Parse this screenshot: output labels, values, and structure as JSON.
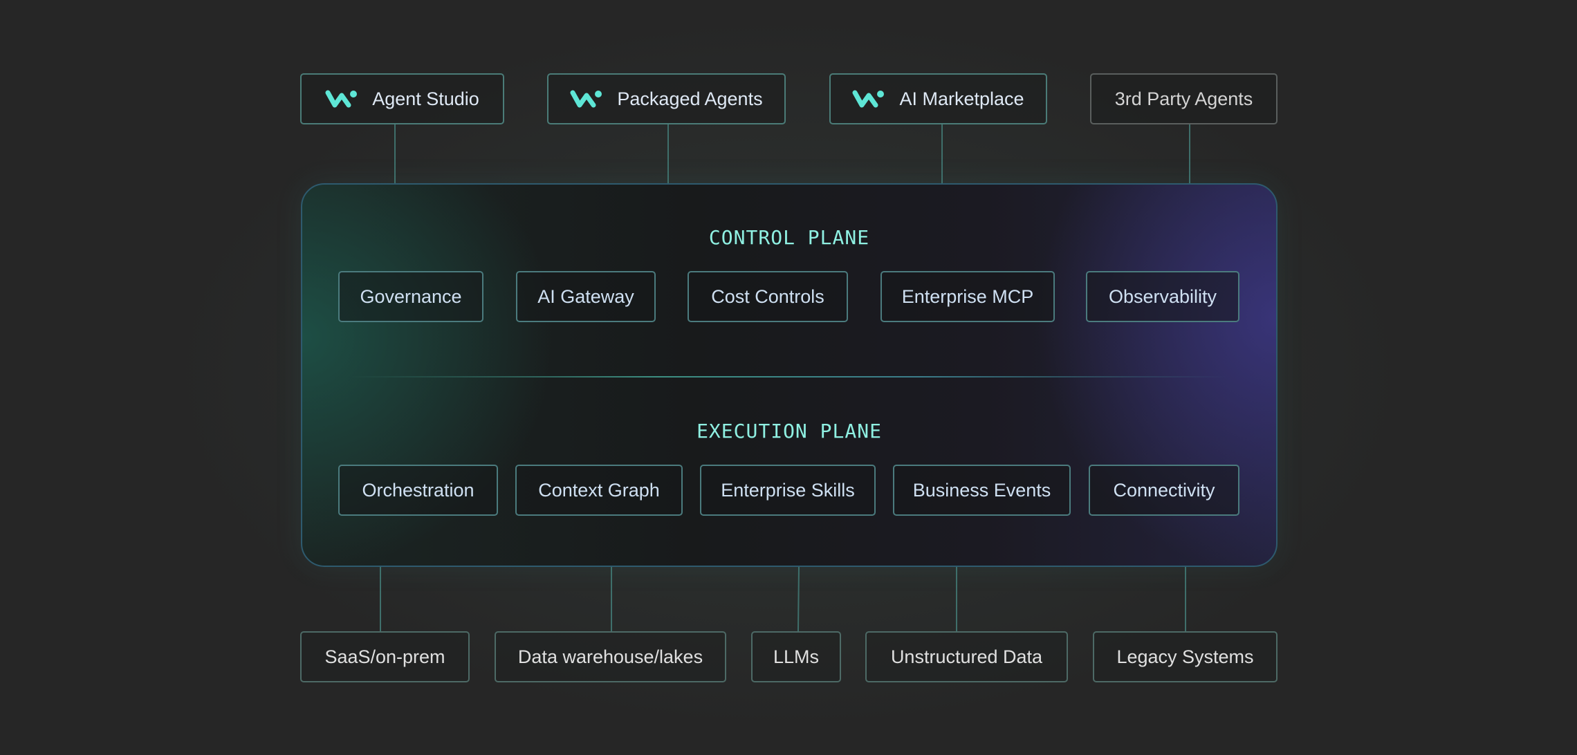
{
  "top_sources": [
    {
      "label": "Agent Studio",
      "icon": "workato-logo-icon"
    },
    {
      "label": "Packaged Agents",
      "icon": "workato-logo-icon"
    },
    {
      "label": "AI Marketplace",
      "icon": "workato-logo-icon"
    },
    {
      "label": "3rd Party Agents"
    }
  ],
  "control_plane": {
    "title": "CONTROL PLANE",
    "items": [
      "Governance",
      "AI Gateway",
      "Cost Controls",
      "Enterprise MCP",
      "Observability"
    ]
  },
  "execution_plane": {
    "title": "EXECUTION PLANE",
    "items": [
      "Orchestration",
      "Context Graph",
      "Enterprise Skills",
      "Business Events",
      "Connectivity"
    ]
  },
  "bottom_sources": [
    "SaaS/on-prem",
    "Data warehouse/lakes",
    "LLMs",
    "Unstructured Data",
    "Legacy Systems"
  ],
  "colors": {
    "accent": "#5ee6d6",
    "title": "#8ff0e2",
    "connector": "#3f6f6b",
    "background": "#262626"
  }
}
